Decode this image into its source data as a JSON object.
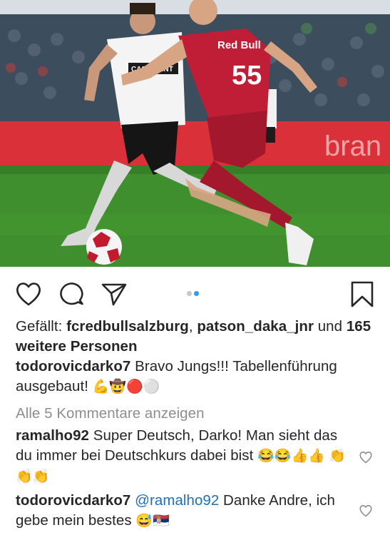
{
  "post": {
    "likes": {
      "prefix": "Gefällt: ",
      "user1": "fcredbullsalzburg",
      "sep": ", ",
      "user2": "patson_daka_jnr",
      "und": " und ",
      "count": "165",
      "suffix": "weitere Personen"
    },
    "caption": {
      "user": "todorovicdarko7",
      "text": " Bravo Jungs!!! Tabellenführung ausgebaut! ",
      "emojis": "💪🤠🔴⚪"
    },
    "view_comments": "Alle 5 Kommentare anzeigen",
    "comments": [
      {
        "user": "ramalho92",
        "text": " Super Deutsch, Darko! Man sieht das du immer bei Deutschkurs dabei bist ",
        "emojis": "😂😂👍👍 👏👏👏"
      },
      {
        "user": "todorovicdarko7",
        "mention": "@ramalho92",
        "text": " Danke Andre, ich gebe mein bestes ",
        "emojis": "😅🇷🇸"
      }
    ]
  },
  "photo": {
    "player_red_number": "55",
    "player_red_sponsor": "Red Bull",
    "player_white_sponsor": "CASHPOINT",
    "board_text": "bran"
  },
  "icons": {
    "like": "heart-icon",
    "comment": "comment-icon",
    "share": "send-icon",
    "save": "bookmark-icon"
  },
  "colors": {
    "link": "#1f6fb5",
    "muted": "#8e8e8e",
    "dot_active": "#3897f0",
    "dot_inactive": "#c7c7c7"
  }
}
